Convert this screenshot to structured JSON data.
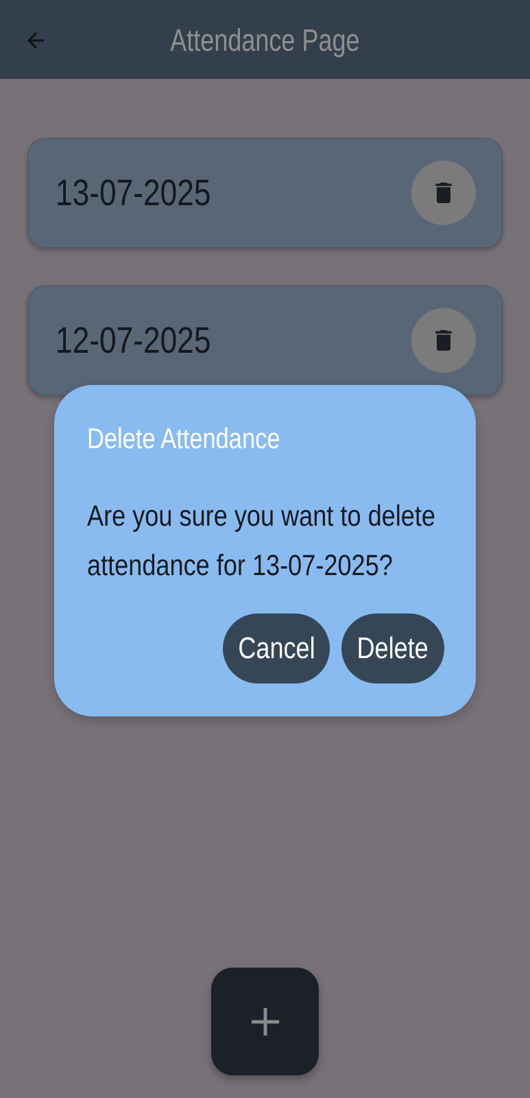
{
  "app_bar": {
    "title": "Attendance Page",
    "back_icon": "arrow-left-icon"
  },
  "attendance_list": [
    {
      "date": "13-07-2025",
      "delete_icon": "trash-icon"
    },
    {
      "date": "12-07-2025",
      "delete_icon": "trash-icon"
    }
  ],
  "dialog": {
    "title": "Delete Attendance",
    "message_line1": "Are you sure you want to delete",
    "message_line2": "attendance for 13-07-2025?",
    "cancel_label": "Cancel",
    "delete_label": "Delete"
  },
  "fab": {
    "icon": "plus-icon"
  },
  "colors": {
    "app_bar_bg": "#333f4c",
    "screen_bg": "#777277",
    "card_bg": "#586676",
    "dialog_bg": "#89bbf0",
    "dialog_button_bg": "#354656",
    "fab_bg": "#1b2029"
  }
}
